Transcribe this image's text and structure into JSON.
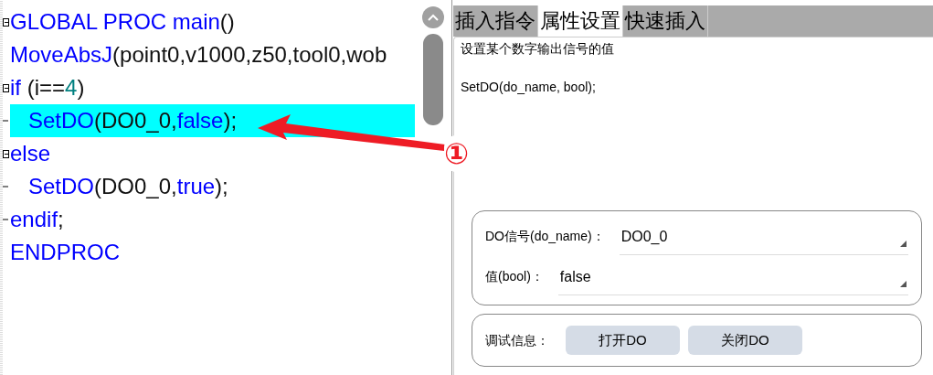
{
  "code_lines": [
    {
      "kind": "fold",
      "selected": false,
      "tokens": [
        {
          "kind": "keyword",
          "text": "GLOBAL PROC main"
        },
        {
          "kind": "plain",
          "text": "()"
        }
      ]
    },
    {
      "kind": "plain",
      "selected": false,
      "tokens": [
        {
          "kind": "keyword",
          "text": "MoveAbsJ"
        },
        {
          "kind": "plain",
          "text": "(point0,v1000,z50,tool0,wob"
        }
      ]
    },
    {
      "kind": "fold",
      "selected": false,
      "tokens": [
        {
          "kind": "keyword",
          "text": "if"
        },
        {
          "kind": "plain",
          "text": " (i=="
        },
        {
          "kind": "number",
          "text": "4"
        },
        {
          "kind": "plain",
          "text": ")"
        }
      ]
    },
    {
      "kind": "branch",
      "selected": true,
      "tokens": [
        {
          "kind": "keyword",
          "text": "   SetDO"
        },
        {
          "kind": "plain",
          "text": "(DO0_0,"
        },
        {
          "kind": "keyword",
          "text": "false"
        },
        {
          "kind": "plain",
          "text": ");"
        }
      ]
    },
    {
      "kind": "fold",
      "selected": false,
      "tokens": [
        {
          "kind": "keyword",
          "text": "else"
        }
      ]
    },
    {
      "kind": "branch",
      "selected": false,
      "tokens": [
        {
          "kind": "keyword",
          "text": "   SetDO"
        },
        {
          "kind": "plain",
          "text": "(DO0_0,"
        },
        {
          "kind": "keyword",
          "text": "true"
        },
        {
          "kind": "plain",
          "text": ");"
        }
      ]
    },
    {
      "kind": "branch",
      "selected": false,
      "tokens": [
        {
          "kind": "keyword",
          "text": "endif"
        },
        {
          "kind": "plain",
          "text": ";"
        }
      ]
    },
    {
      "kind": "plain",
      "selected": false,
      "tokens": [
        {
          "kind": "keyword",
          "text": "ENDPROC"
        }
      ]
    }
  ],
  "annotation": {
    "label": "①"
  },
  "tabs": [
    {
      "label": "插入指令",
      "selected": false
    },
    {
      "label": "属性设置",
      "selected": true
    },
    {
      "label": "快速插入",
      "selected": false
    }
  ],
  "description": "设置某个数字输出信号的值",
  "signature": "SetDO(do_name, bool);",
  "fields": [
    {
      "label": "DO信号(do_name)：",
      "value": "DO0_0"
    },
    {
      "label": "值(bool)：",
      "value": "false"
    }
  ],
  "debug": {
    "label": "调试信息：",
    "buttons": [
      "打开DO",
      "关闭DO"
    ]
  }
}
